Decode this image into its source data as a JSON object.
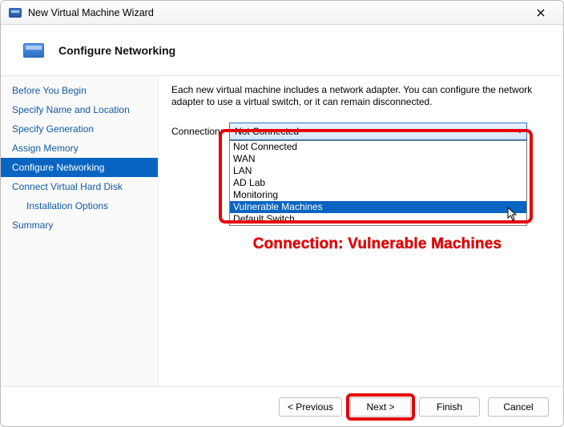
{
  "window": {
    "title": "New Virtual Machine Wizard"
  },
  "header": {
    "title": "Configure Networking"
  },
  "sidebar": {
    "items": [
      {
        "label": "Before You Begin",
        "indent": 0,
        "active": false
      },
      {
        "label": "Specify Name and Location",
        "indent": 0,
        "active": false
      },
      {
        "label": "Specify Generation",
        "indent": 0,
        "active": false
      },
      {
        "label": "Assign Memory",
        "indent": 0,
        "active": false
      },
      {
        "label": "Configure Networking",
        "indent": 0,
        "active": true
      },
      {
        "label": "Connect Virtual Hard Disk",
        "indent": 0,
        "active": false
      },
      {
        "label": "Installation Options",
        "indent": 1,
        "active": false
      },
      {
        "label": "Summary",
        "indent": 0,
        "active": false
      }
    ]
  },
  "main": {
    "intro": "Each new virtual machine includes a network adapter. You can configure the network adapter to use a virtual switch, or it can remain disconnected.",
    "connection_label": "Connection:",
    "combo_value": "Not Connected",
    "options": [
      "Not Connected",
      "WAN",
      "LAN",
      "AD Lab",
      "Monitoring",
      "Vulnerable Machines",
      "Default Switch"
    ],
    "highlighted_option_index": 5
  },
  "annotation": {
    "text": "Connection: Vulnerable Machines"
  },
  "footer": {
    "previous": "< Previous",
    "next": "Next >",
    "finish": "Finish",
    "cancel": "Cancel"
  }
}
